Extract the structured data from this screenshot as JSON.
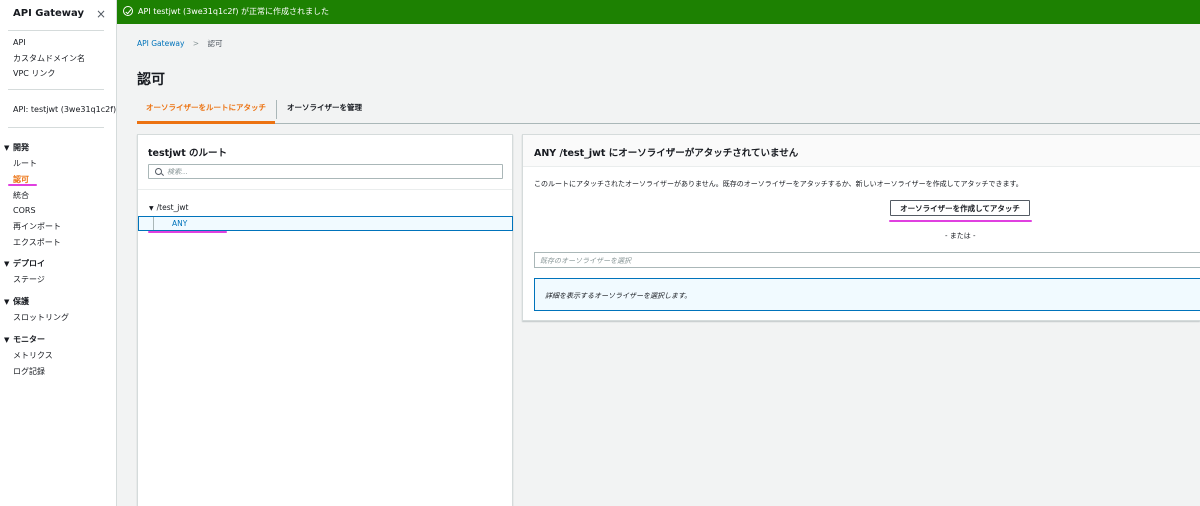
{
  "sidebar": {
    "title": "API Gateway",
    "close_icon": "×",
    "top_items": [
      "API",
      "カスタムドメイン名",
      "VPC リンク"
    ],
    "api_item": "API: testjwt (3we31q1c2f)",
    "sections": [
      {
        "name": "開発",
        "items": [
          "ルート",
          "認可",
          "統合",
          "CORS",
          "再インポート",
          "エクスポート"
        ]
      },
      {
        "name": "デプロイ",
        "items": [
          "ステージ"
        ]
      },
      {
        "name": "保護",
        "items": [
          "スロットリング"
        ]
      },
      {
        "name": "モニター",
        "items": [
          "メトリクス",
          "ログ記録"
        ]
      }
    ],
    "active_item": "認可"
  },
  "flash": {
    "message": "API testjwt (3we31q1c2f) が正常に作成されました",
    "color": "#1d8102"
  },
  "breadcrumb": {
    "root": "API Gateway",
    "current": "認可"
  },
  "page_title": "認可",
  "tabs": [
    {
      "label": "オーソライザーをルートにアタッチ",
      "active": true
    },
    {
      "label": "オーソライザーを管理",
      "active": false
    }
  ],
  "routes_panel": {
    "title": "testjwt のルート",
    "search_placeholder": "検索...",
    "route_path": "/test_jwt",
    "method": "ANY"
  },
  "detail_panel": {
    "title": "ANY /test_jwt にオーソライザーがアタッチされていません",
    "description": "このルートにアタッチされたオーソライザーがありません。既存のオーソライザーをアタッチするか、新しいオーソライザーを作成してアタッチできます。",
    "create_button": "オーソライザーを作成してアタッチ",
    "or_text": "- または -",
    "select_placeholder": "既存のオーソライザーを選択",
    "info_text": "詳細を表示するオーソライザーを選択します。"
  },
  "colors": {
    "accent": "#ec7211",
    "link": "#0073bb",
    "highlight": "#e040e0"
  }
}
